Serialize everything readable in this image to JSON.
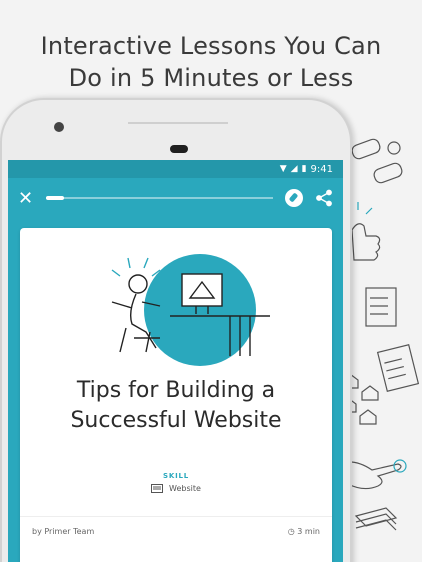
{
  "headline": {
    "line1": "Interactive Lessons You Can",
    "line2": "Do in 5 Minutes or Less"
  },
  "status_bar": {
    "time": "9:41"
  },
  "toolbar": {
    "close_icon": "close-icon",
    "progress": 0.08,
    "compass_icon": "compass-icon",
    "share_icon": "share-icon"
  },
  "card": {
    "title_line1": "Tips for Building a",
    "title_line2": "Successful Website",
    "skill_label": "SKILL",
    "skill_name": "Website",
    "author": "by Primer Team",
    "duration": "3 min"
  },
  "colors": {
    "accent": "#2aa8bd",
    "statusbar": "#2497aa",
    "background": "#f3f3f3"
  }
}
